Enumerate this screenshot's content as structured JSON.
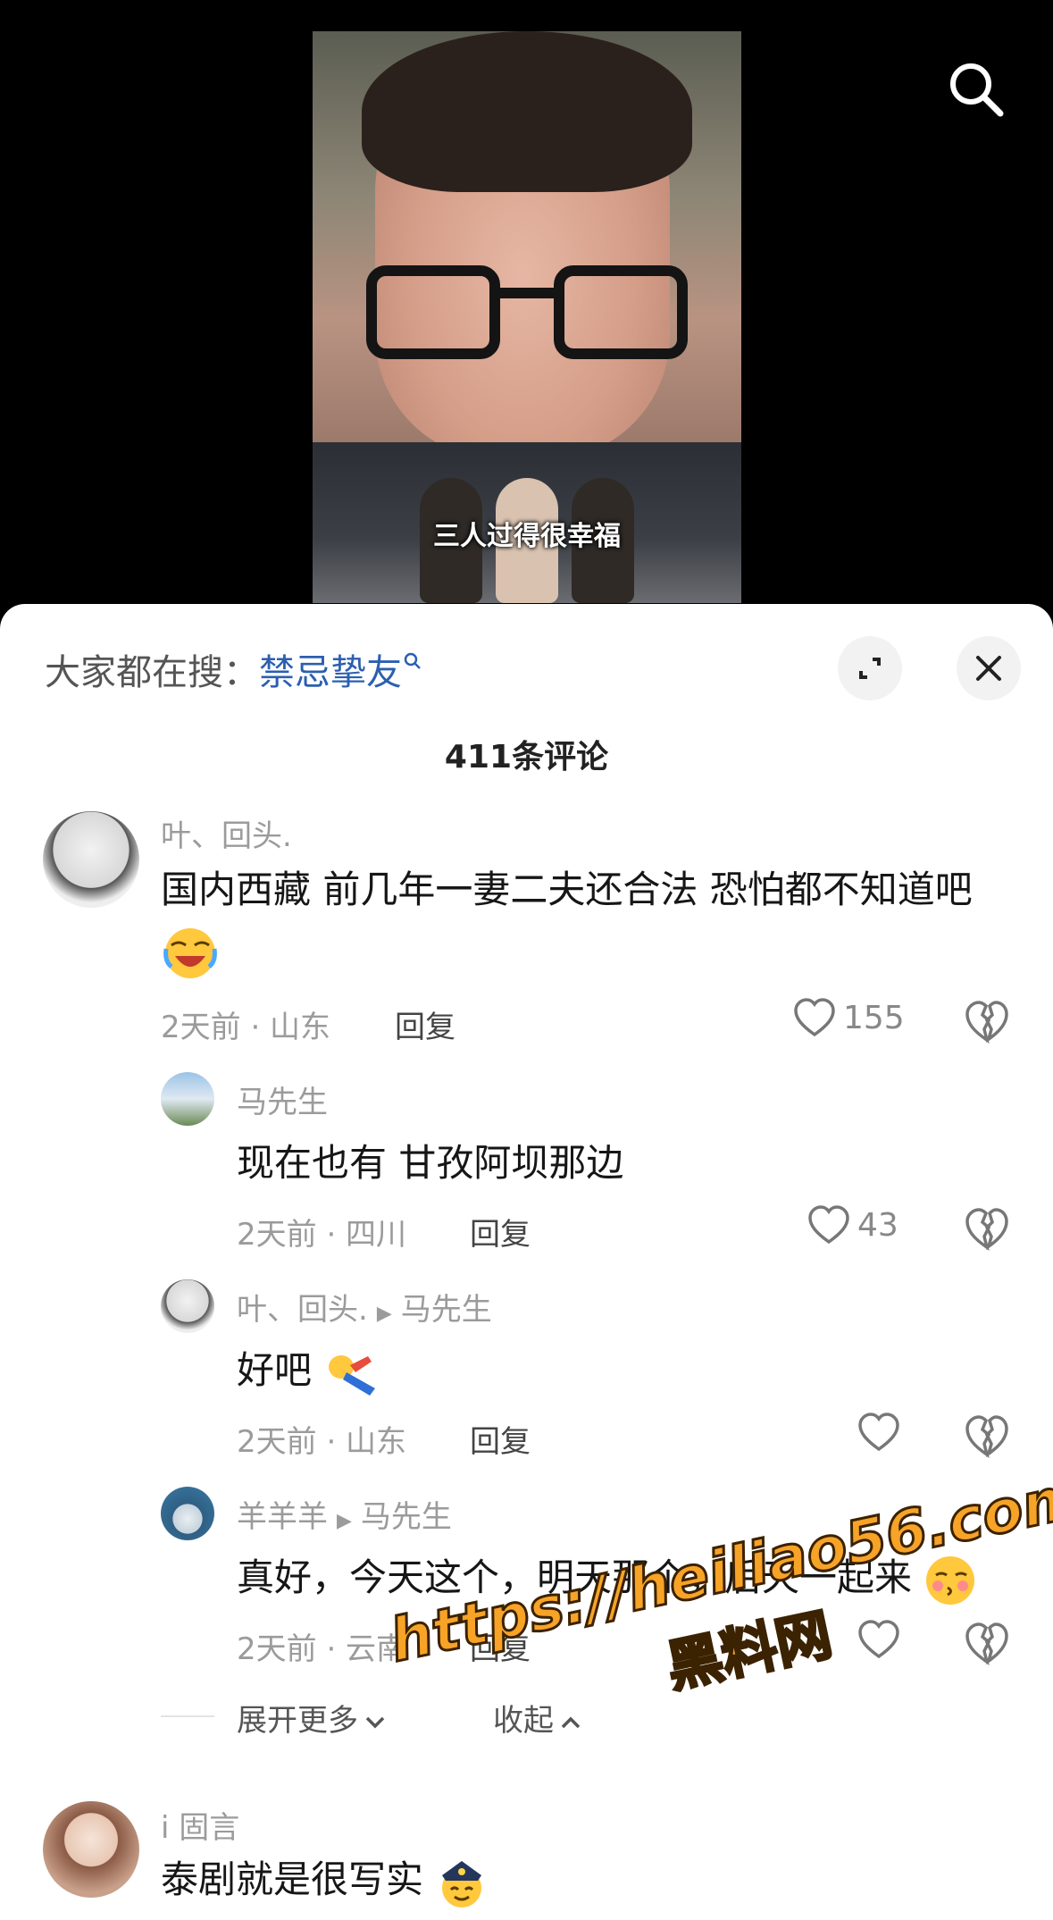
{
  "video": {
    "caption": "三人过得很幸福"
  },
  "sheet": {
    "hot_prefix": "大家都在搜：",
    "hot_keyword": "禁忌挚友",
    "comment_count": "411条评论"
  },
  "comments": [
    {
      "user": "叶、回头.",
      "text": "国内西藏 前几年一妻二夫还合法 恐怕都不知道吧",
      "meta": "2天前 · 山东",
      "reply": "回复",
      "likes": "155"
    }
  ],
  "replies": [
    {
      "user": "马先生",
      "target": "",
      "text": "现在也有 甘孜阿坝那边",
      "meta": "2天前 · 四川",
      "reply": "回复",
      "likes": "43"
    },
    {
      "user": "叶、回头.",
      "target": "马先生",
      "text": "好吧",
      "meta": "2天前 · 山东",
      "reply": "回复",
      "likes": ""
    },
    {
      "user": "羊羊羊",
      "target": "马先生",
      "text": "真好，今天这个，明天那个，后天一起来",
      "meta": "2天前 · 云南",
      "reply": "回复",
      "likes": ""
    }
  ],
  "expand": {
    "more": "展开更多",
    "collapse": "收起"
  },
  "comment2": {
    "user": "i 固言",
    "text": "泰剧就是很写实"
  },
  "watermark": {
    "url": "https://heiliao56.com",
    "name": "黑料网"
  }
}
